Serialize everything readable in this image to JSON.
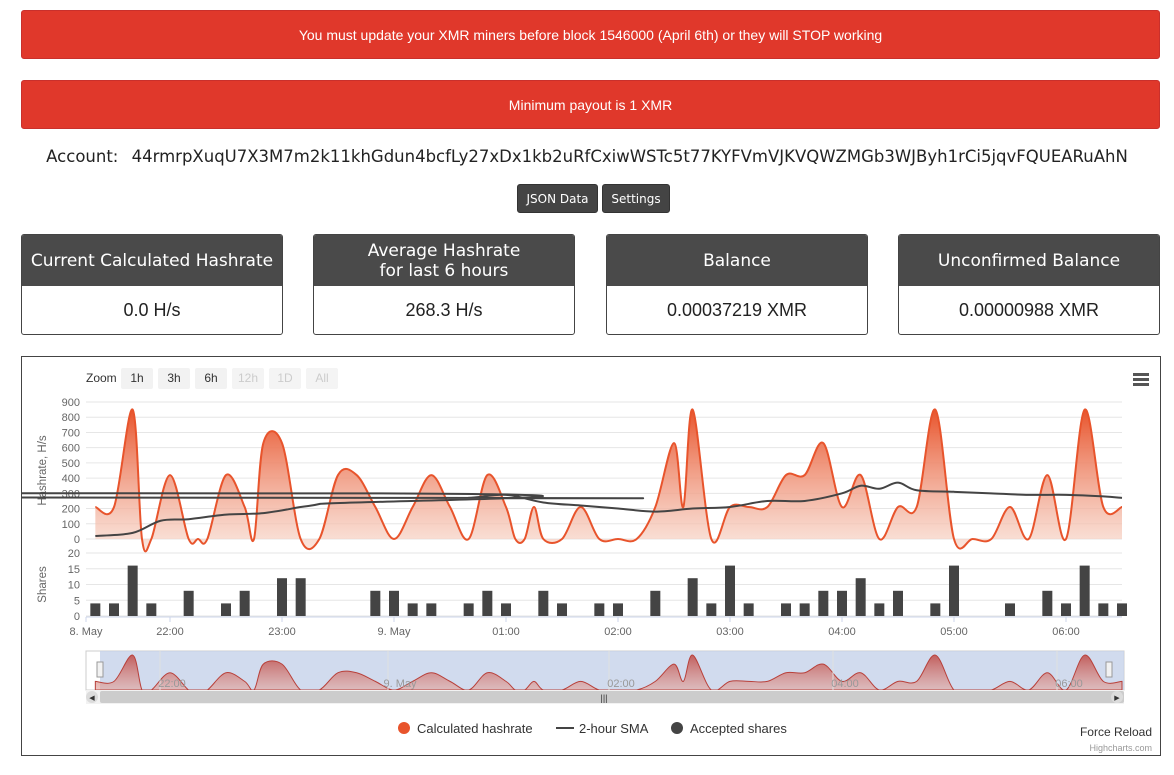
{
  "alerts": [
    "You must update your XMR miners before block 1546000 (April 6th) or they will STOP working",
    "Minimum payout is 1 XMR"
  ],
  "account": {
    "label": "Account:",
    "address": "44rmrpXuqU7X3M7m2k11khGdun4bcfLy27xDx1kb2uRfCxiwWSTc5t77KYFVmVJKVQWZMGb3WJByh1rCi5jqvFQUEARuAhN"
  },
  "buttons": {
    "json": "JSON Data",
    "settings": "Settings"
  },
  "stats": [
    {
      "title": "Current Calculated Hashrate",
      "value": "0.0 H/s"
    },
    {
      "title": "Average Hashrate\nfor last 6 hours",
      "value": "268.3 H/s"
    },
    {
      "title": "Balance",
      "value": "0.00037219 XMR"
    },
    {
      "title": "Unconfirmed Balance",
      "value": "0.00000988 XMR"
    }
  ],
  "colors": {
    "hashrate": "#e8542c",
    "sma": "#444444",
    "shares": "#444444",
    "alert": "#e0382b"
  },
  "chart_data": {
    "type": "line",
    "zoom": {
      "label": "Zoom",
      "buttons": [
        "1h",
        "3h",
        "6h",
        "12h",
        "1D",
        "All"
      ],
      "disabled": [
        "12h",
        "1D",
        "All"
      ]
    },
    "menu_icon": "hamburger-menu-icon",
    "hashrate_axis": {
      "title": "Hashrate, H/s",
      "ticks": [
        0,
        100,
        200,
        300,
        400,
        500,
        600,
        700,
        800,
        900
      ],
      "ylim": [
        0,
        900
      ]
    },
    "shares_axis": {
      "title": "Shares",
      "ticks": [
        0,
        5,
        10,
        15,
        20
      ],
      "ylim": [
        0,
        20
      ]
    },
    "time_range": [
      "8 May 21:15",
      "9 May 06:30"
    ],
    "x_ticks": [
      {
        "t": "8 May 21:15",
        "label": "8. May"
      },
      {
        "t": "8 May 22:00",
        "label": "22:00"
      },
      {
        "t": "8 May 23:00",
        "label": "23:00"
      },
      {
        "t": "9 May 00:00",
        "label": "9. May"
      },
      {
        "t": "9 May 01:00",
        "label": "01:00"
      },
      {
        "t": "9 May 02:00",
        "label": "02:00"
      },
      {
        "t": "9 May 03:00",
        "label": "03:00"
      },
      {
        "t": "9 May 04:00",
        "label": "04:00"
      },
      {
        "t": "9 May 05:00",
        "label": "05:00"
      },
      {
        "t": "9 May 06:00",
        "label": "06:00"
      }
    ],
    "navigator_ticks": [
      "22:00",
      "9. May",
      "02:00",
      "04:00",
      "06:00"
    ],
    "series": [
      {
        "name": "Calculated hashrate",
        "type": "areaspline",
        "x": [
          "8 May 21:20",
          "8 May 21:30",
          "8 May 21:40",
          "8 May 21:45",
          "8 May 21:50",
          "8 May 22:00",
          "8 May 22:10",
          "8 May 22:15",
          "8 May 22:20",
          "8 May 22:30",
          "8 May 22:40",
          "8 May 22:45",
          "8 May 22:50",
          "8 May 23:00",
          "8 May 23:10",
          "8 May 23:20",
          "8 May 23:30",
          "8 May 23:40",
          "8 May 23:50",
          "9 May 00:00",
          "9 May 00:10",
          "9 May 00:20",
          "9 May 00:30",
          "9 May 00:40",
          "9 May 00:50",
          "9 May 01:00",
          "9 May 01:05",
          "9 May 01:10",
          "9 May 01:15",
          "9 May 01:20",
          "9 May 01:30",
          "9 May 01:40",
          "9 May 01:50",
          "9 May 02:00",
          "9 May 02:10",
          "9 May 02:20",
          "9 May 02:30",
          "9 May 02:35",
          "9 May 02:40",
          "9 May 02:50",
          "9 May 03:00",
          "9 May 03:10",
          "9 May 03:20",
          "9 May 03:30",
          "9 May 03:40",
          "9 May 03:50",
          "9 May 04:00",
          "9 May 04:10",
          "9 May 04:20",
          "9 May 04:30",
          "9 May 04:40",
          "9 May 04:50",
          "9 May 05:00",
          "9 May 05:10",
          "9 May 05:20",
          "9 May 05:30",
          "9 May 05:40",
          "9 May 05:50",
          "9 May 06:00",
          "9 May 06:10",
          "9 May 06:20",
          "9 May 06:30"
        ],
        "values": [
          210,
          210,
          850,
          0,
          0,
          420,
          0,
          0,
          0,
          420,
          210,
          0,
          630,
          630,
          0,
          0,
          420,
          420,
          210,
          0,
          210,
          420,
          210,
          0,
          420,
          210,
          0,
          0,
          210,
          0,
          0,
          210,
          0,
          0,
          0,
          210,
          630,
          210,
          850,
          0,
          210,
          210,
          210,
          420,
          420,
          630,
          210,
          420,
          0,
          210,
          210,
          850,
          0,
          0,
          0,
          210,
          0,
          420,
          0,
          850,
          210,
          210
        ]
      },
      {
        "name": "2-hour SMA",
        "type": "spline",
        "x": [
          "8 May 21:20",
          "8 May 21:40",
          "8 May 21:55",
          "8 May 22:10",
          "8 May 22:30",
          "8 May 22:50",
          "8 May 23:10",
          "8 May 23:20",
          "8 May 23:40",
          "8 May 00:00",
          "9 May 00:20",
          "9 May 00:40",
          "9 May 01:00",
          "9 May 01:20",
          "9 May 01:40",
          "9 May 02:00",
          "9 May 02:20",
          "9 May 02:40",
          "9 May 03:00",
          "9 May 03:20",
          "9 May 03:40",
          "9 May 04:00",
          "9 May 04:10",
          "9 May 04:20",
          "9 May 04:30",
          "9 May 04:40",
          "9 May 05:00",
          "9 May 05:20",
          "9 May 05:40",
          "9 May 06:00",
          "9 May 06:20",
          "9 May 06:30"
        ],
        "values": [
          20,
          40,
          120,
          130,
          160,
          170,
          210,
          230,
          300,
          290,
          270,
          270,
          290,
          240,
          220,
          200,
          180,
          200,
          210,
          250,
          250,
          300,
          350,
          330,
          370,
          320,
          310,
          300,
          290,
          290,
          280,
          270
        ]
      },
      {
        "name": "Accepted shares",
        "type": "column",
        "x": [
          "8 May 21:20",
          "8 May 21:30",
          "8 May 21:40",
          "8 May 21:50",
          "8 May 22:10",
          "8 May 22:30",
          "8 May 22:40",
          "8 May 23:00",
          "8 May 23:10",
          "8 May 23:50",
          "9 May 00:00",
          "9 May 00:10",
          "9 May 00:20",
          "9 May 00:40",
          "9 May 00:50",
          "9 May 01:00",
          "9 May 01:20",
          "9 May 01:30",
          "9 May 01:50",
          "9 May 02:00",
          "9 May 02:20",
          "9 May 02:40",
          "9 May 02:50",
          "9 May 03:00",
          "9 May 03:10",
          "9 May 03:30",
          "9 May 03:40",
          "9 May 03:50",
          "9 May 04:00",
          "9 May 04:10",
          "9 May 04:20",
          "9 May 04:30",
          "9 May 04:50",
          "9 May 05:00",
          "9 May 05:30",
          "9 May 05:50",
          "9 May 06:00",
          "9 May 06:10",
          "9 May 06:20",
          "9 May 06:30"
        ],
        "values": [
          4,
          4,
          16,
          4,
          8,
          4,
          8,
          12,
          12,
          8,
          8,
          4,
          4,
          4,
          8,
          4,
          8,
          4,
          4,
          4,
          8,
          12,
          4,
          16,
          4,
          4,
          4,
          8,
          8,
          12,
          4,
          8,
          4,
          16,
          4,
          8,
          4,
          16,
          4,
          4
        ]
      }
    ],
    "footer": {
      "force_reload": "Force Reload",
      "credits": "Highcharts.com"
    }
  }
}
